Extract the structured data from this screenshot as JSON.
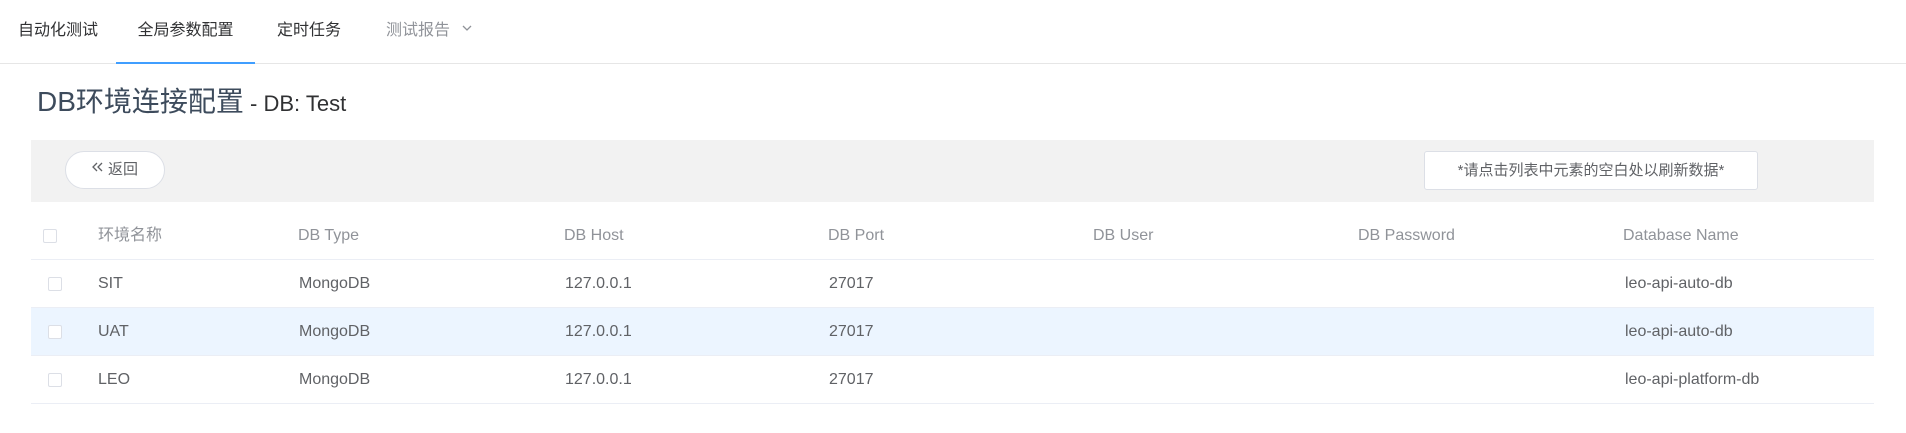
{
  "nav": {
    "items": [
      {
        "label": "自动化测试"
      },
      {
        "label": "全局参数配置"
      },
      {
        "label": "定时任务"
      },
      {
        "label": "测试报告"
      }
    ],
    "active_index": 1,
    "accent_color": "#409eff"
  },
  "page": {
    "title_main": "DB环境连接配置",
    "title_sub": " - DB: Test"
  },
  "toolbar": {
    "back_label": "返回",
    "hint_text": "*请点击列表中元素的空白处以刷新数据*"
  },
  "table": {
    "columns": [
      "环境名称",
      "DB Type",
      "DB Host",
      "DB Port",
      "DB User",
      "DB Password",
      "Database Name"
    ],
    "rows": [
      {
        "name": "SIT",
        "type": "MongoDB",
        "host": "127.0.0.1",
        "port": "27017",
        "user": "",
        "password": "",
        "database": "leo-api-auto-db"
      },
      {
        "name": "UAT",
        "type": "MongoDB",
        "host": "127.0.0.1",
        "port": "27017",
        "user": "",
        "password": "",
        "database": "leo-api-auto-db"
      },
      {
        "name": "LEO",
        "type": "MongoDB",
        "host": "127.0.0.1",
        "port": "27017",
        "user": "",
        "password": "",
        "database": "leo-api-platform-db"
      }
    ],
    "highlight_row_color": "#ecf5ff"
  }
}
